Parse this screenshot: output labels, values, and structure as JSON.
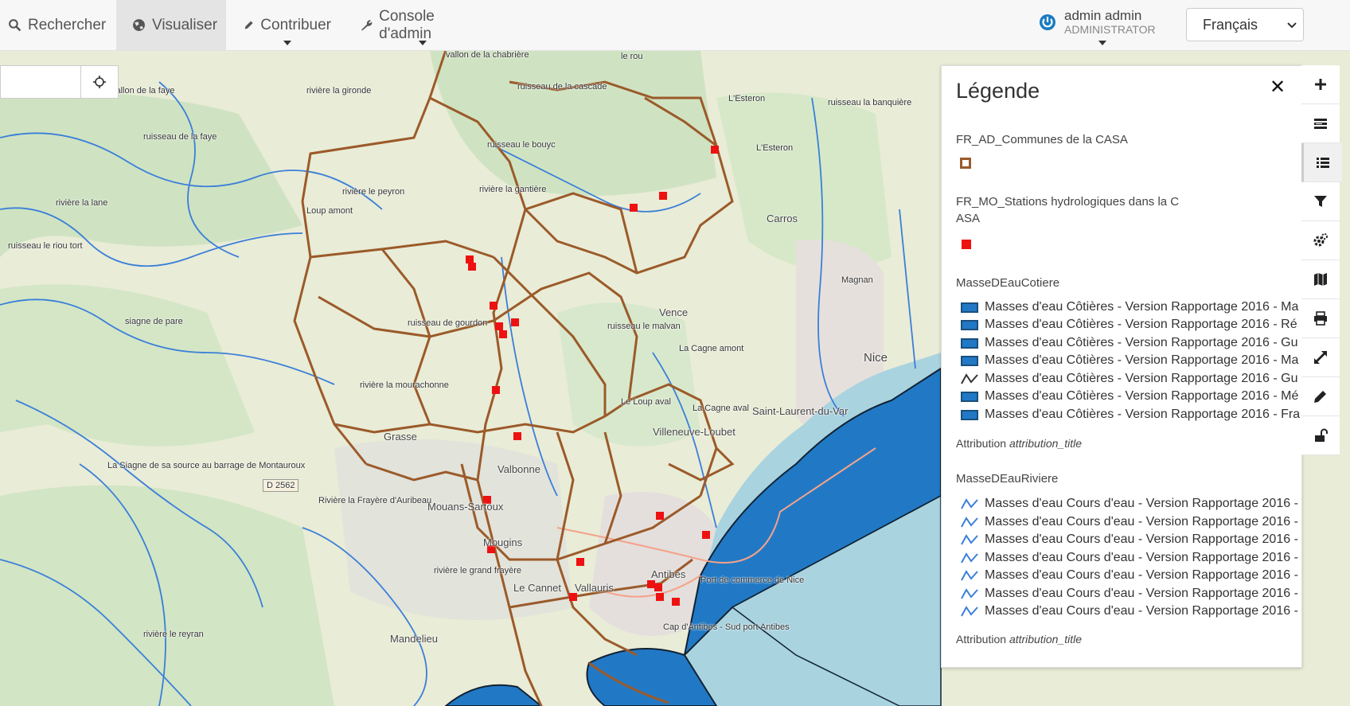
{
  "nav": {
    "search_label": "Rechercher",
    "visualize_label": "Visualiser",
    "contribute_label": "Contribuer",
    "admin_label": "Console d'admin"
  },
  "user": {
    "name": "admin admin",
    "role": "ADMINISTRATOR"
  },
  "language": {
    "selected": "Français"
  },
  "legend": {
    "title": "Légende",
    "layers": [
      {
        "name": "FR_AD_Communes de la CASA",
        "attribution": ""
      },
      {
        "name": "FR_MO_Stations hydrologiques dans la C",
        "name_line2": "ASA"
      },
      {
        "name": "MasseDEauCotiere",
        "items": [
          "Masses d'eau Côtières - Version Rapportage 2016 - Ma",
          "Masses d'eau Côtières - Version Rapportage 2016 - Ré",
          "Masses d'eau Côtières - Version Rapportage 2016 - Gu",
          "Masses d'eau Côtières - Version Rapportage 2016 - Ma",
          "Masses d'eau Côtières - Version Rapportage 2016 - Gu",
          "Masses d'eau Côtières - Version Rapportage 2016 - Mé",
          "Masses d'eau Côtières - Version Rapportage 2016 - Fra"
        ],
        "attribution_label": "Attribution",
        "attribution_value": "attribution_title"
      },
      {
        "name": "MasseDEauRiviere",
        "items": [
          "Masses d'eau Cours d'eau - Version Rapportage 2016 -",
          "Masses d'eau Cours d'eau - Version Rapportage 2016 -",
          "Masses d'eau Cours d'eau - Version Rapportage 2016 -",
          "Masses d'eau Cours d'eau - Version Rapportage 2016 -",
          "Masses d'eau Cours d'eau - Version Rapportage 2016 -",
          "Masses d'eau Cours d'eau - Version Rapportage 2016 -",
          "Masses d'eau Cours d'eau - Version Rapportage 2016 -"
        ],
        "attribution_label": "Attribution",
        "attribution_value": "attribution_title"
      }
    ]
  },
  "map": {
    "labels": [
      "vallon de la chabrière",
      "le rou",
      "L'Esteron",
      "L'Esteron",
      "ruisseau la banquière",
      "ruisseau de la faye",
      "vallon de la faye",
      "rivière la gironde",
      "ruisseau le bouyc",
      "rivière le peyron",
      "rivière la gantière",
      "rivière la lane",
      "ruisseau de la cascade",
      "Loup amont",
      "ruisseau le riou tort",
      "Carros",
      "Magnan",
      "siagne de pare",
      "ruisseau de gourdon",
      "Vence",
      "ruisseau le malvan",
      "rivière la mourachonne",
      "La Cagne amont",
      "Le Loup aval",
      "La Cagne aval",
      "Saint-Laurent-du-Var",
      "Nice",
      "Grasse",
      "Villeneuve-Loubet",
      "Valbonne",
      "Mouans-Sartoux",
      "D 2562",
      "La Siagne de sa source au barrage de Montauroux",
      "Rivière la Frayère d'Auribeau",
      "Mougins",
      "Le Cannet",
      "Vallauris",
      "Antibes",
      "Mandelieu",
      "Port de commerce de Nice",
      "Cap d'Antibes - Sud port Antibes",
      "rivière le grand frayère",
      "rivière le reyran"
    ]
  },
  "colors": {
    "boundary": "#9b5a2a",
    "station": "#ee1111",
    "coastal_water": "#2179c5",
    "river": "#3a7fd9",
    "sea": "#a9d3df",
    "land": "#e9ecd6"
  },
  "toolbar": {
    "icons": [
      "zoom-in-icon",
      "layers-icon",
      "legend-list-icon",
      "filter-icon",
      "settings-icon",
      "map-icon",
      "print-icon",
      "fullscreen-icon",
      "edit-icon",
      "unlock-icon"
    ]
  }
}
